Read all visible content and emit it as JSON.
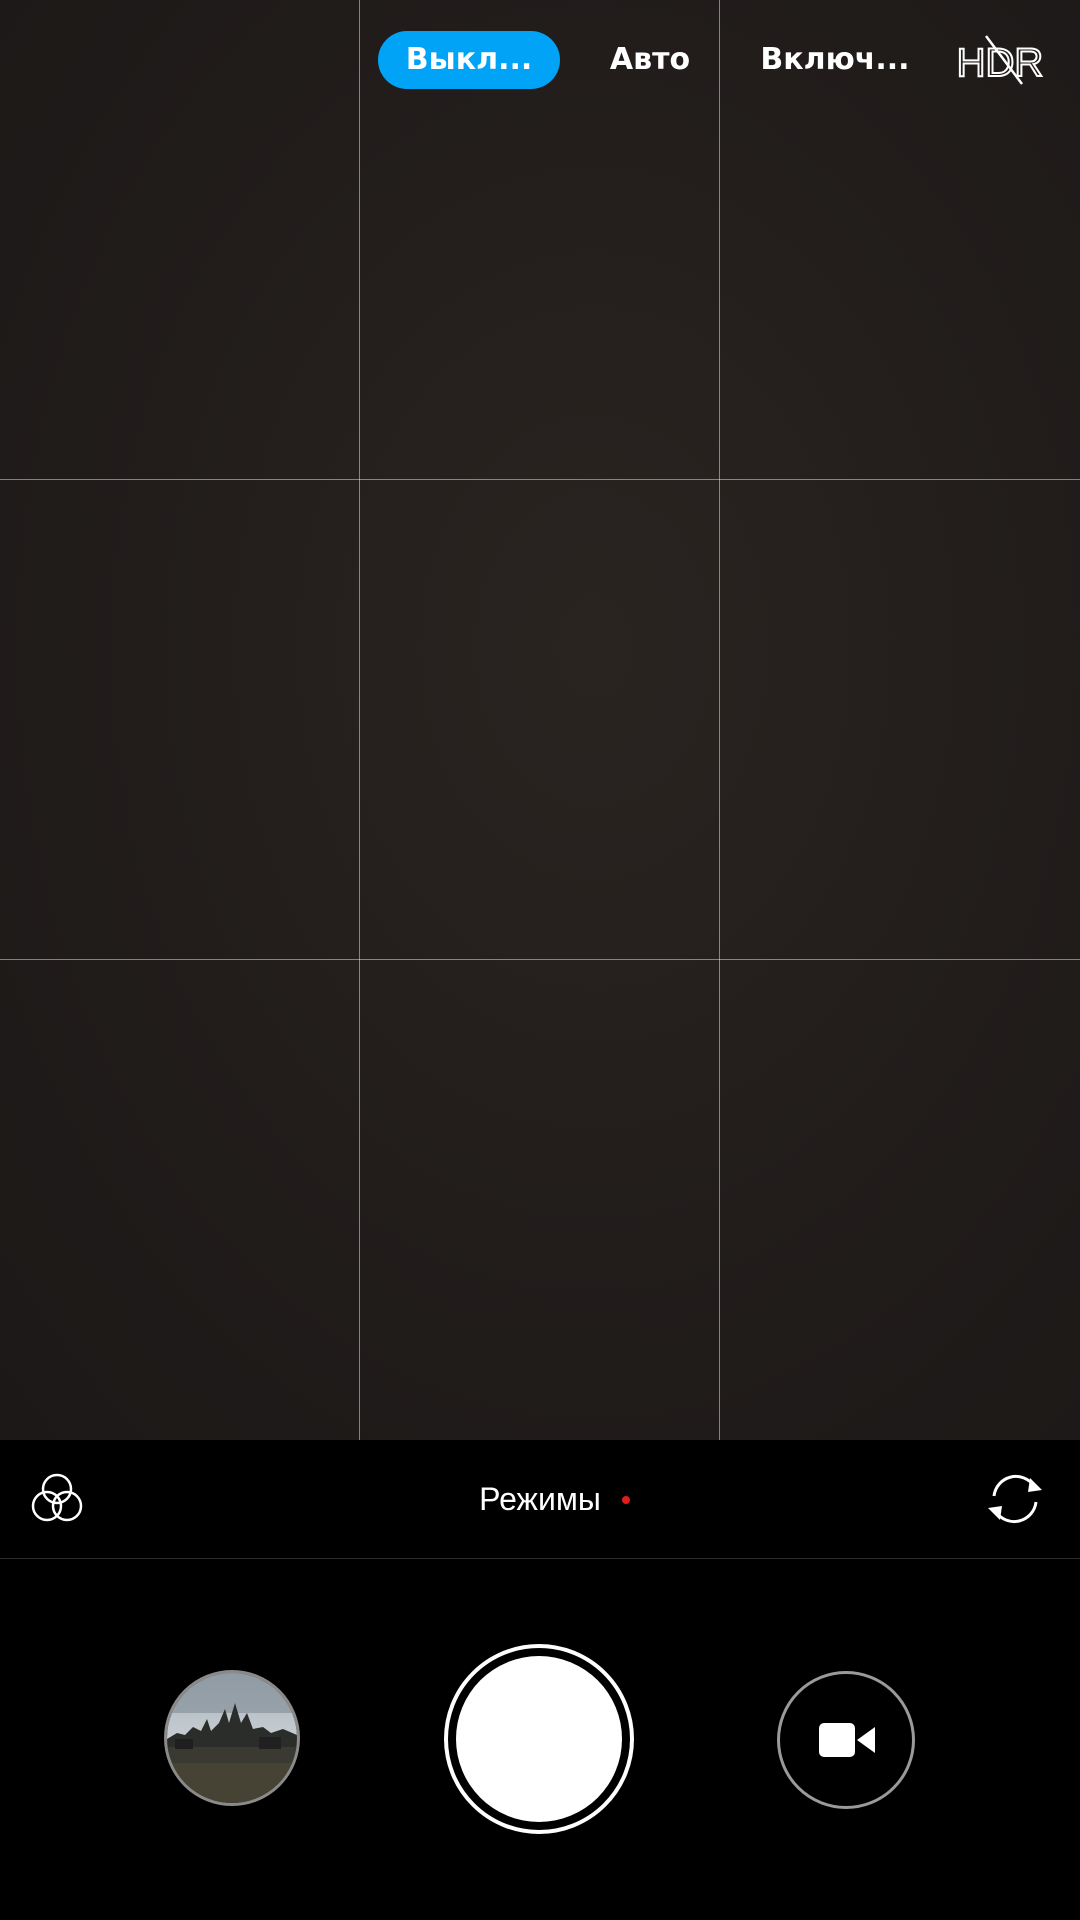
{
  "hdr_options": {
    "off_label": "Выкл...",
    "auto_label": "Авто",
    "on_label": "Включ...",
    "selected": "off",
    "hdr_icon_text": "HDR",
    "hdr_icon_name": "hdr-off-icon"
  },
  "mode_bar": {
    "filters_icon": "filters-icon",
    "modes_label": "Режимы",
    "new_indicator_color": "#e21b1b",
    "switch_camera_icon": "switch-camera-icon"
  },
  "controls": {
    "gallery_icon": "gallery-thumbnail",
    "shutter_icon": "shutter-button",
    "video_icon": "video-camera-icon"
  },
  "colors": {
    "accent": "#00a3f5",
    "background": "#000000",
    "viewfinder": "#231e1c"
  }
}
